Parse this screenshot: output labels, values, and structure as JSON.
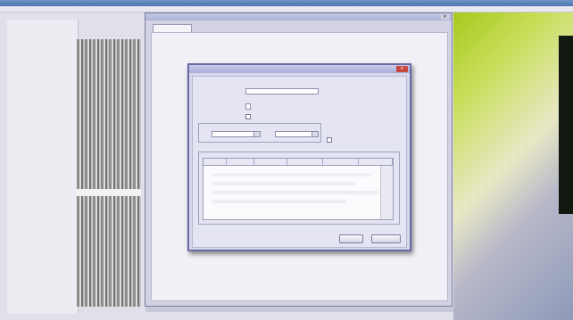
{
  "app": {
    "title": "",
    "menu": ""
  },
  "left_pane": {
    "counter": ""
  },
  "outer_window": {
    "title": "",
    "close": "×",
    "tab": ""
  },
  "dialog": {
    "title": "",
    "title_center": "",
    "close": "×",
    "fields": [
      {
        "label": "",
        "value": ""
      },
      {
        "label": "",
        "value": ""
      },
      {
        "label": "",
        "value": ""
      }
    ],
    "date_group": {
      "label": "",
      "from_label": "",
      "from_value": "",
      "to_label": "",
      "to_value": ""
    },
    "show_all": {
      "label": "",
      "checked": false
    },
    "list": {
      "label": "",
      "columns": [
        "",
        "",
        "",
        "",
        "",
        ""
      ]
    },
    "buttons": {
      "ok": "",
      "cancel": ""
    }
  }
}
